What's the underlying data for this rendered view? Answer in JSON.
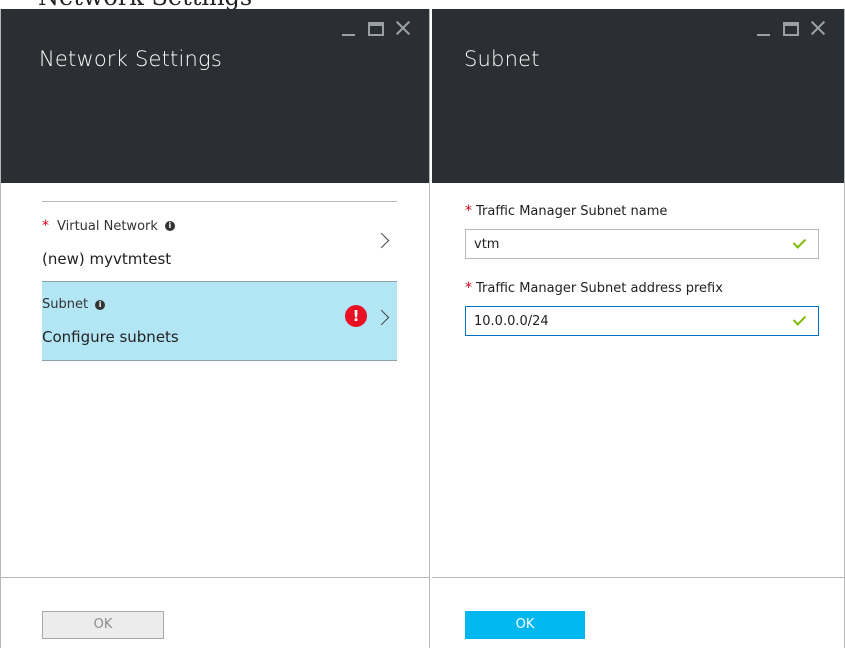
{
  "top_strip": {
    "text": "Network Settings"
  },
  "left_blade": {
    "title": "Network Settings",
    "items": [
      {
        "label": "Virtual Network",
        "required": true,
        "value": "(new) myvtmtest"
      },
      {
        "label": "Subnet",
        "required": false,
        "value": "Configure subnets",
        "selected": true,
        "error": true
      }
    ],
    "ok_label": "OK"
  },
  "right_blade": {
    "title": "Subnet",
    "fields": [
      {
        "label": "Traffic Manager Subnet name",
        "value": "vtm",
        "valid": true
      },
      {
        "label": "Traffic Manager Subnet address prefix",
        "value": "10.0.0.0/24",
        "valid": true,
        "focused": true
      }
    ],
    "ok_label": "OK"
  },
  "icons": {
    "info": "i",
    "error": "!"
  },
  "colors": {
    "header": "#2b2f33",
    "selected_item": "#b3e6f5",
    "primary_button": "#00b7f0",
    "error": "#e81123",
    "valid": "#7fba00",
    "required": "#d0021b"
  }
}
